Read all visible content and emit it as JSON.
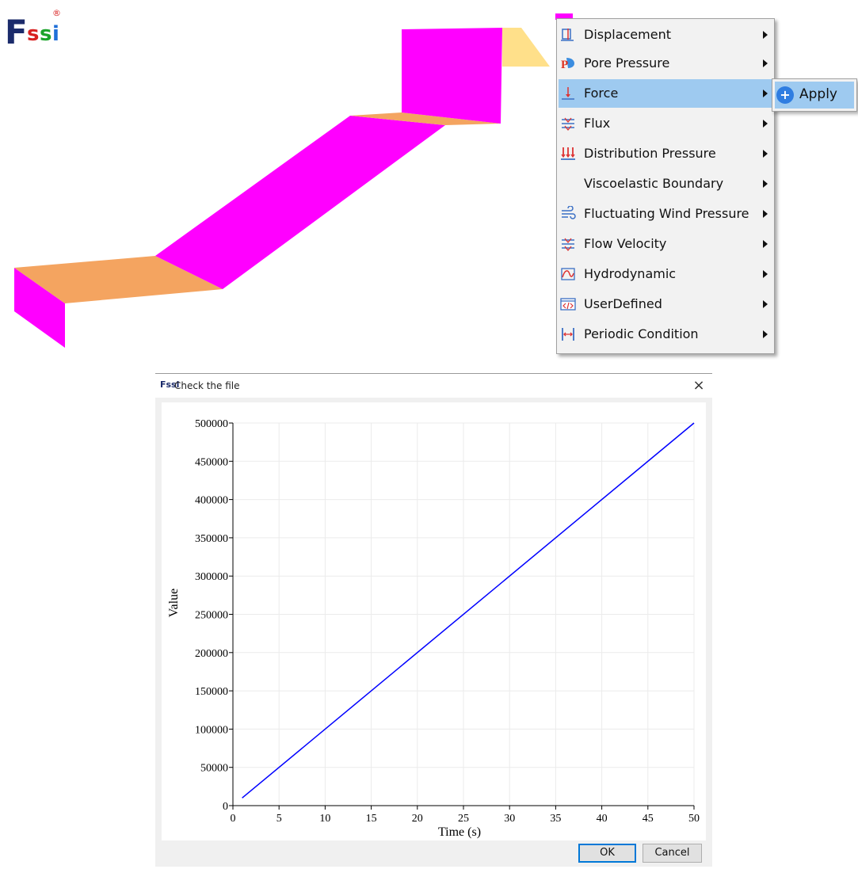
{
  "logo": {
    "f": "F",
    "s1": "s",
    "s2": "s",
    "i": "i",
    "reg": "®"
  },
  "context_menu": {
    "items": [
      {
        "label": "Displacement",
        "icon": "displacement-icon"
      },
      {
        "label": "Pore Pressure",
        "icon": "pore-pressure-icon"
      },
      {
        "label": "Force",
        "icon": "force-icon",
        "highlighted": true
      },
      {
        "label": "Flux",
        "icon": "flux-icon"
      },
      {
        "label": "Distribution Pressure",
        "icon": "distribution-pressure-icon"
      },
      {
        "label": "Viscoelastic Boundary",
        "icon": ""
      },
      {
        "label": "Fluctuating Wind Pressure",
        "icon": "wind-icon"
      },
      {
        "label": "Flow Velocity",
        "icon": "flow-velocity-icon"
      },
      {
        "label": "Hydrodynamic",
        "icon": "hydrodynamic-icon"
      },
      {
        "label": "UserDefined",
        "icon": "code-icon"
      },
      {
        "label": "Periodic Condition",
        "icon": "periodic-icon"
      }
    ],
    "submenu": {
      "apply_label": "Apply",
      "icon": "plus-circle-icon"
    }
  },
  "dialog": {
    "title": "Check the file",
    "title_icon_text": "Fssi",
    "close_glyph": "×",
    "ok_label": "OK",
    "cancel_label": "Cancel"
  },
  "colors": {
    "line": "#0000ff",
    "magenta": "#ff00ff",
    "orange": "#f4a460",
    "highlight": "#9ecaf0"
  },
  "chart_data": {
    "type": "line",
    "title": "",
    "xlabel": "Time (s)",
    "ylabel": "Value",
    "xlim": [
      0,
      50
    ],
    "ylim": [
      0,
      500000
    ],
    "xticks": [
      0,
      5,
      10,
      15,
      20,
      25,
      30,
      35,
      40,
      45,
      50
    ],
    "yticks": [
      0,
      50000,
      100000,
      150000,
      200000,
      250000,
      300000,
      350000,
      400000,
      450000,
      500000
    ],
    "grid": true,
    "series": [
      {
        "x": [
          1,
          50
        ],
        "y": [
          10000,
          500000
        ]
      }
    ]
  }
}
